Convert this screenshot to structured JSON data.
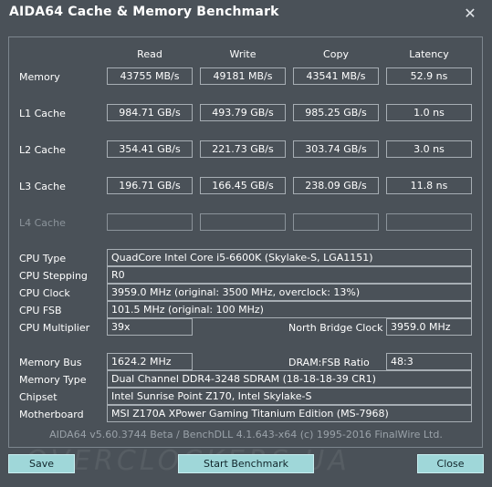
{
  "window": {
    "title": "AIDA64 Cache & Memory Benchmark",
    "close_glyph": "✕"
  },
  "columns": {
    "read": "Read",
    "write": "Write",
    "copy": "Copy",
    "latency": "Latency"
  },
  "rows": [
    {
      "label": "Memory",
      "read": "43755 MB/s",
      "write": "49181 MB/s",
      "copy": "43541 MB/s",
      "latency": "52.9 ns"
    },
    {
      "label": "L1 Cache",
      "read": "984.71 GB/s",
      "write": "493.79 GB/s",
      "copy": "985.25 GB/s",
      "latency": "1.0 ns"
    },
    {
      "label": "L2 Cache",
      "read": "354.41 GB/s",
      "write": "221.73 GB/s",
      "copy": "303.74 GB/s",
      "latency": "3.0 ns"
    },
    {
      "label": "L3 Cache",
      "read": "196.71 GB/s",
      "write": "166.45 GB/s",
      "copy": "238.09 GB/s",
      "latency": "11.8 ns"
    },
    {
      "label": "L4 Cache",
      "read": "",
      "write": "",
      "copy": "",
      "latency": ""
    }
  ],
  "info": {
    "cpu_type": {
      "label": "CPU Type",
      "value": "QuadCore Intel Core i5-6600K  (Skylake-S, LGA1151)"
    },
    "cpu_stepping": {
      "label": "CPU Stepping",
      "value": "R0"
    },
    "cpu_clock": {
      "label": "CPU Clock",
      "value": "3959.0 MHz  (original: 3500 MHz, overclock: 13%)"
    },
    "cpu_fsb": {
      "label": "CPU FSB",
      "value": "101.5 MHz  (original: 100 MHz)"
    },
    "cpu_multiplier": {
      "label": "CPU Multiplier",
      "value": "39x"
    },
    "nb_clock": {
      "label": "North Bridge Clock",
      "value": "3959.0 MHz"
    },
    "memory_bus": {
      "label": "Memory Bus",
      "value": "1624.2 MHz"
    },
    "dram_fsb": {
      "label": "DRAM:FSB Ratio",
      "value": "48:3"
    },
    "memory_type": {
      "label": "Memory Type",
      "value": "Dual Channel DDR4-3248 SDRAM  (18-18-18-39 CR1)"
    },
    "chipset": {
      "label": "Chipset",
      "value": "Intel Sunrise Point Z170, Intel Skylake-S"
    },
    "motherboard": {
      "label": "Motherboard",
      "value": "MSI Z170A XPower Gaming Titanium Edition (MS-7968)"
    }
  },
  "footer": "AIDA64 v5.60.3744 Beta / BenchDLL 4.1.643-x64  (c) 1995-2016 FinalWire Ltd.",
  "buttons": {
    "save": "Save",
    "start": "Start Benchmark",
    "close": "Close"
  },
  "watermark": "OVERCLOCKERS.UA",
  "colors": {
    "background": "#4a5158",
    "button": "#9fd7d9",
    "border": "#a7aeb4"
  }
}
